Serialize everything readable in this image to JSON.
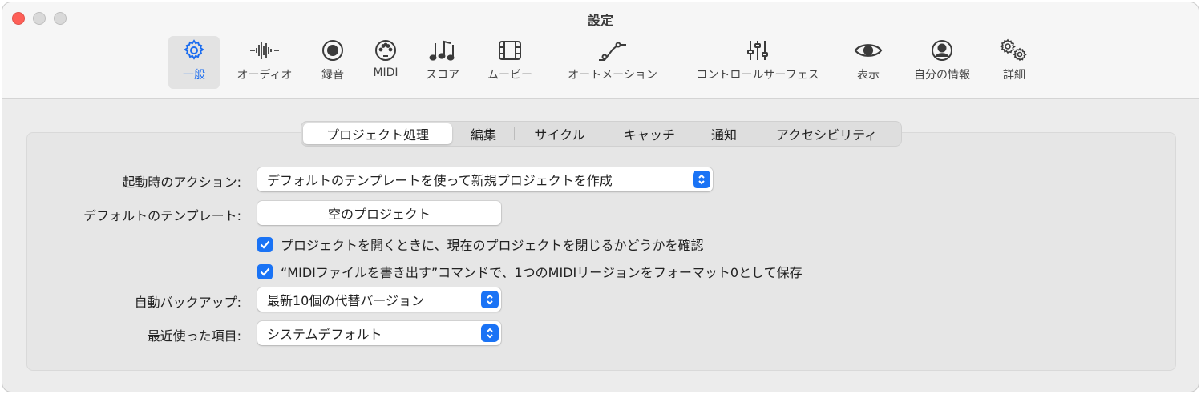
{
  "window": {
    "title": "設定"
  },
  "toolbar": {
    "items": [
      {
        "label": "一般",
        "icon": "gear-icon",
        "active": true
      },
      {
        "label": "オーディオ",
        "icon": "waveform-icon"
      },
      {
        "label": "録音",
        "icon": "record-icon"
      },
      {
        "label": "MIDI",
        "icon": "midi-port-icon"
      },
      {
        "label": "スコア",
        "icon": "music-notes-icon"
      },
      {
        "label": "ムービー",
        "icon": "film-icon"
      },
      {
        "label": "オートメーション",
        "icon": "automation-icon"
      },
      {
        "label": "コントロールサーフェス",
        "icon": "sliders-icon"
      },
      {
        "label": "表示",
        "icon": "eye-icon"
      },
      {
        "label": "自分の情報",
        "icon": "person-icon"
      },
      {
        "label": "詳細",
        "icon": "gears-icon"
      }
    ]
  },
  "tabs": [
    {
      "label": "プロジェクト処理",
      "active": true
    },
    {
      "label": "編集"
    },
    {
      "label": "サイクル"
    },
    {
      "label": "キャッチ"
    },
    {
      "label": "通知"
    },
    {
      "label": "アクセシビリティ"
    }
  ],
  "settings": {
    "startup_action": {
      "label": "起動時のアクション:",
      "value": "デフォルトのテンプレートを使って新規プロジェクトを作成"
    },
    "default_template": {
      "label": "デフォルトのテンプレート:",
      "value": "空のプロジェクト"
    },
    "confirm_close": {
      "text": "プロジェクトを開くときに、現在のプロジェクトを閉じるかどうかを確認",
      "checked": true
    },
    "midi_export": {
      "text": "“MIDIファイルを書き出す”コマンドで、1つのMIDIリージョンをフォーマット0として保存",
      "checked": true
    },
    "auto_backup": {
      "label": "自動バックアップ:",
      "value": "最新10個の代替バージョン"
    },
    "recent_items": {
      "label": "最近使った項目:",
      "value": "システムデフォルト"
    }
  },
  "colors": {
    "accent": "#1a73f5",
    "close": "#fe5f57"
  }
}
